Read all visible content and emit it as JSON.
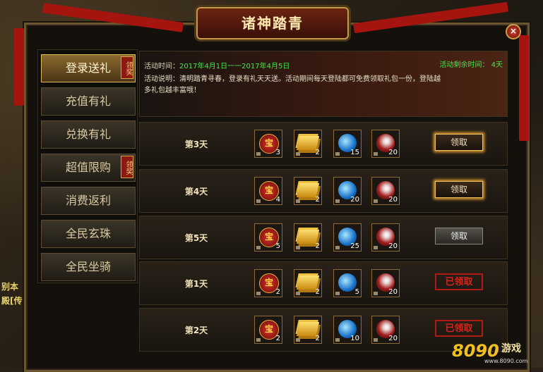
{
  "title": "诸神踏青",
  "background_text": [
    "别本",
    "殿[传"
  ],
  "tabs": [
    {
      "label": "登录送礼",
      "badge": "领奖",
      "active": true
    },
    {
      "label": "充值有礼",
      "badge": "",
      "active": false
    },
    {
      "label": "兑换有礼",
      "badge": "",
      "active": false
    },
    {
      "label": "超值限购",
      "badge": "领奖",
      "active": false
    },
    {
      "label": "消费返利",
      "badge": "",
      "active": false
    },
    {
      "label": "全民玄珠",
      "badge": "",
      "active": false
    },
    {
      "label": "全民坐骑",
      "badge": "",
      "active": false
    }
  ],
  "info": {
    "time_label": "活动时间：",
    "time_value": "2017年4月1日一一2017年4月5日",
    "remaining": "活动剩余时间： 4天",
    "description": "活动说明：清明踏青寻春，登录有礼天天送。活动期间每天登陆都可免费领取礼包一份，登陆越多礼包越丰富哦！"
  },
  "rows": [
    {
      "day": "第3天",
      "counts": [
        "3",
        "2",
        "15",
        "20"
      ],
      "button": "领取",
      "state": "claimable"
    },
    {
      "day": "第4天",
      "counts": [
        "4",
        "2",
        "20",
        "20"
      ],
      "button": "领取",
      "state": "claimable"
    },
    {
      "day": "第5天",
      "counts": [
        "5",
        "2",
        "25",
        "20"
      ],
      "button": "领取",
      "state": "locked"
    },
    {
      "day": "第1天",
      "counts": [
        "2",
        "2",
        "5",
        "20"
      ],
      "button": "已领取",
      "state": "claimed"
    },
    {
      "day": "第2天",
      "counts": [
        "2",
        "2",
        "10",
        "20"
      ],
      "button": "已领取",
      "state": "claimed"
    }
  ],
  "item_icons": [
    "seal-icon",
    "gold-bar-icon",
    "blue-orb-icon",
    "red-orb-icon"
  ],
  "seal_char": "宝",
  "close_glyph": "×",
  "logo": {
    "number": "8090",
    "text": "游戏",
    "url": "www.8090.com"
  },
  "colors": {
    "accent_green": "#42e84a",
    "claimed_red": "#d8241a",
    "gold": "#e0b860"
  }
}
